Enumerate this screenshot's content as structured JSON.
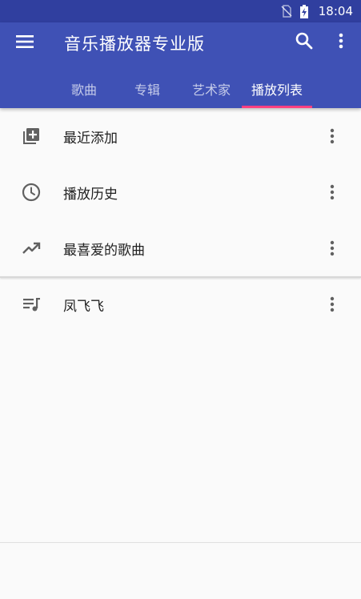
{
  "status_bar": {
    "time": "18:04",
    "icons": [
      "no-sim-icon",
      "battery-charging-icon"
    ]
  },
  "app_bar": {
    "title": "音乐播放器专业版",
    "menu_icon": "menu-icon",
    "search_icon": "search-icon",
    "overflow_icon": "more-vert-icon",
    "background": "#3f51b5",
    "status_background": "#303f9f",
    "indicator_color": "#ff4081"
  },
  "tabs": [
    {
      "label": "歌曲",
      "active": false
    },
    {
      "label": "专辑",
      "active": false
    },
    {
      "label": "艺术家",
      "active": false
    },
    {
      "label": "播放列表",
      "active": true
    }
  ],
  "playlists": [
    {
      "label": "最近添加",
      "icon": "playlist-add-icon"
    },
    {
      "label": "播放历史",
      "icon": "history-clock-icon"
    },
    {
      "label": "最喜爱的歌曲",
      "icon": "trending-up-icon"
    },
    {
      "label": "凤飞飞",
      "icon": "playlist-music-icon"
    }
  ]
}
